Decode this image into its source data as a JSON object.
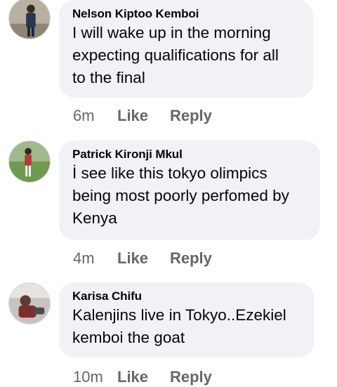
{
  "comments": [
    {
      "author": "Nelson Kiptoo Kemboi",
      "lines": [
        "I will wake up in the morning",
        "expecting qualifications for all",
        "to the final"
      ],
      "time": "6m",
      "like": "Like",
      "reply": "Reply"
    },
    {
      "author": "Patrick Kironji Mkul",
      "lines": [
        "İ see like this tokyo olimpics",
        "being most poorly perfomed by",
        "Kenya"
      ],
      "time": "4m",
      "like": "Like",
      "reply": "Reply"
    },
    {
      "author": "Karisa Chifu",
      "lines": [
        "Kalenjins live in Tokyo..Ezekiel",
        "kemboi the goat"
      ],
      "time": "10m",
      "like": "Like",
      "reply": "Reply"
    }
  ]
}
